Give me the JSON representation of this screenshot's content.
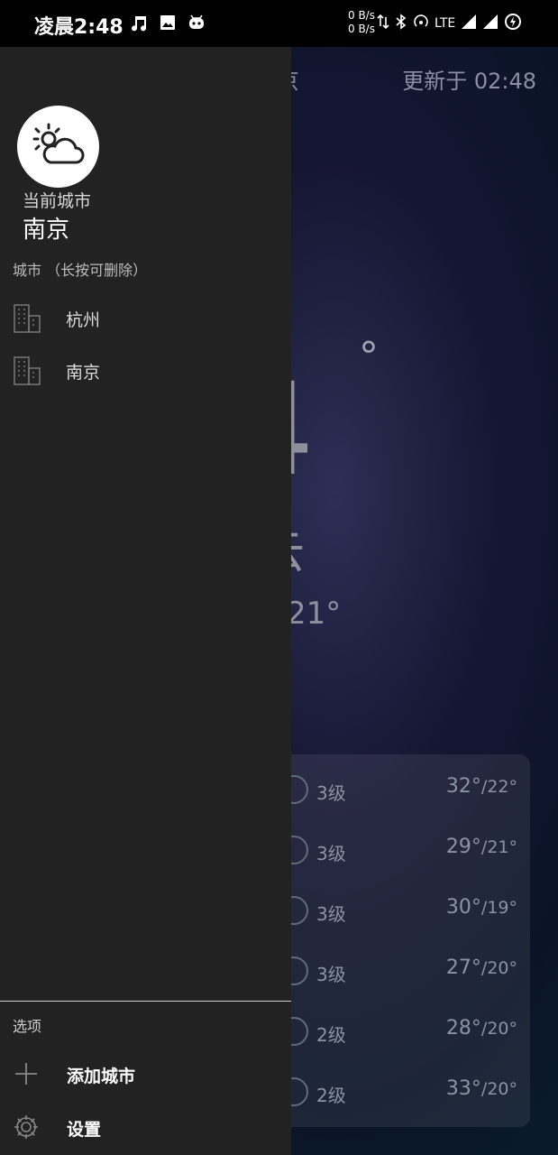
{
  "status_bar": {
    "time": "凌晨2:48",
    "net_up": "0 B/s",
    "net_down": "0 B/s",
    "network": "LTE",
    "icons": [
      "music-note-icon",
      "image-icon",
      "robot-icon",
      "data-arrows-icon",
      "bluetooth-icon",
      "hotspot-icon",
      "signal-icon",
      "signal-icon-2",
      "battery-charging-icon"
    ]
  },
  "weather": {
    "city_partial": "京",
    "updated": "更新于 02:48",
    "temp_partial": "4",
    "degree": "°",
    "condition_partial": "云",
    "range_partial": "21°",
    "forecast": [
      {
        "level": "3级",
        "high": "32°",
        "low": "/22°"
      },
      {
        "level": "3级",
        "high": "29°",
        "low": "/21°"
      },
      {
        "level": "3级",
        "high": "30°",
        "low": "/19°"
      },
      {
        "level": "3级",
        "high": "27°",
        "low": "/20°"
      },
      {
        "level": "2级",
        "high": "28°",
        "low": "/20°"
      },
      {
        "level": "2级",
        "high": "33°",
        "low": "/20°"
      }
    ]
  },
  "drawer": {
    "avatar_icon": "partly-cloudy-icon",
    "current_label": "当前城市",
    "current_city": "南京",
    "cities_label": "城市 （长按可删除）",
    "cities": [
      "杭州",
      "南京"
    ],
    "options_label": "选项",
    "options": [
      {
        "label": "添加城市",
        "icon": "plus-icon"
      },
      {
        "label": "设置",
        "icon": "gear-icon"
      }
    ]
  },
  "colors": {
    "drawer_bg": "#222222",
    "status_bar_bg": "#000000"
  }
}
